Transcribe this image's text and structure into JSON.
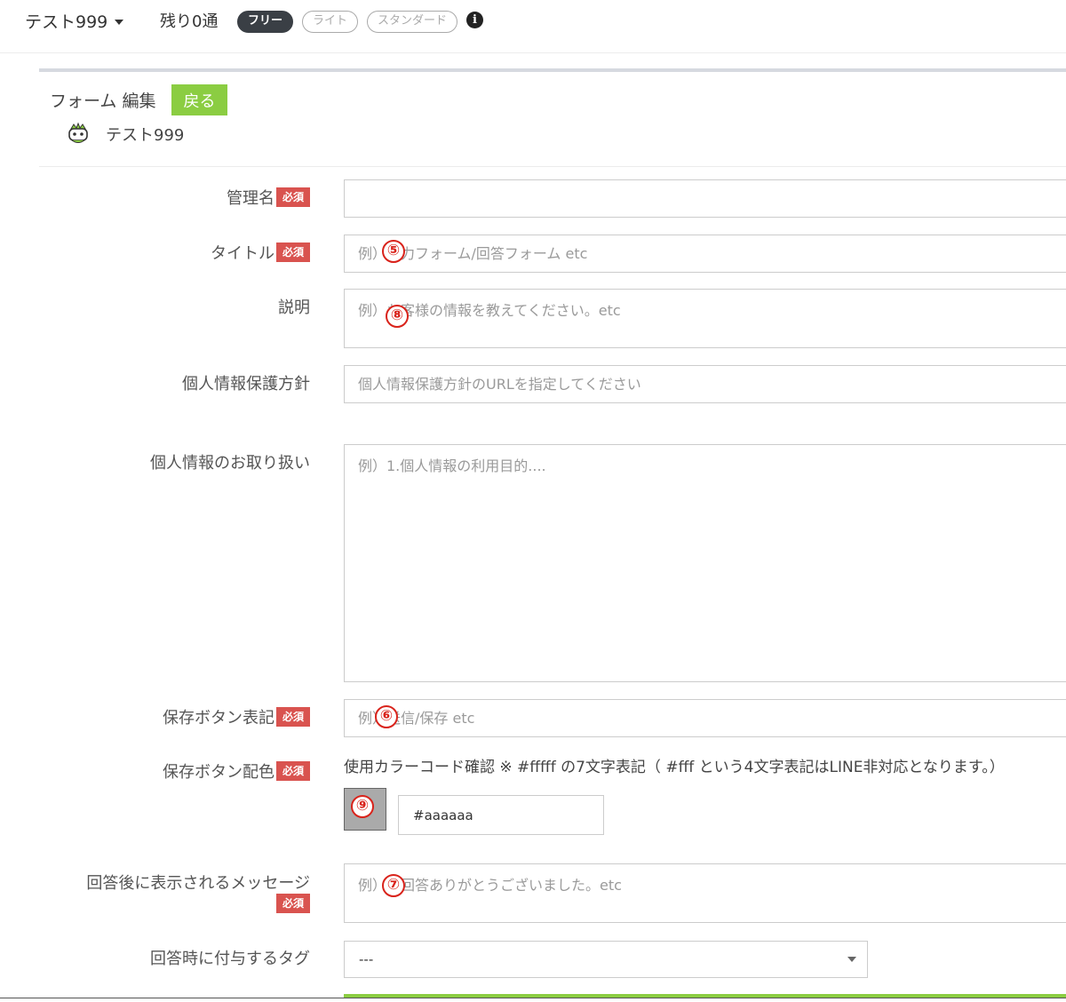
{
  "header": {
    "account_name": "テスト999",
    "remaining": "残り0通",
    "plans": [
      {
        "label": "フリー",
        "active": true
      },
      {
        "label": "ライト",
        "active": false
      },
      {
        "label": "スタンダード",
        "active": false
      }
    ],
    "info_icon": "info-circle-icon"
  },
  "panel": {
    "title": "フォーム 編集",
    "back_label": "戻る",
    "bot_name": "テスト999",
    "bot_icon": "bot-avatar-icon"
  },
  "form": {
    "required_label": "必須",
    "admin_name": {
      "label": "管理名",
      "value": ""
    },
    "title": {
      "label": "タイトル",
      "placeholder": "例）入力フォーム/回答フォーム etc"
    },
    "description": {
      "label": "説明",
      "placeholder": "例）お客様の情報を教えてください。etc"
    },
    "privacy_policy": {
      "label": "個人情報保護方針",
      "placeholder": "個人情報保護方針のURLを指定してください"
    },
    "personal_info_handling": {
      "label": "個人情報のお取り扱い",
      "placeholder": "例）1.個人情報の利用目的...."
    },
    "save_button_text": {
      "label": "保存ボタン表記",
      "placeholder": "例）送信/保存 etc"
    },
    "save_button_color": {
      "label": "保存ボタン配色",
      "hint": "使用カラーコード確認 ※ #fffff の7文字表記（ #fff という4文字表記はLINE非対応となります。）",
      "value": "#aaaaaa",
      "swatch_color": "#aaaaaa"
    },
    "after_message": {
      "label": "回答後に表示されるメッセージ",
      "placeholder": "例）ご回答ありがとうございました。etc"
    },
    "tag": {
      "label": "回答時に付与するタグ",
      "selected": "---"
    }
  },
  "markers": [
    "⑤",
    "⑧",
    "⑥",
    "⑨",
    "⑦"
  ],
  "colors": {
    "accent_green": "#8bcd42",
    "required_red": "#d9534f",
    "marker_red": "#d9231b"
  }
}
